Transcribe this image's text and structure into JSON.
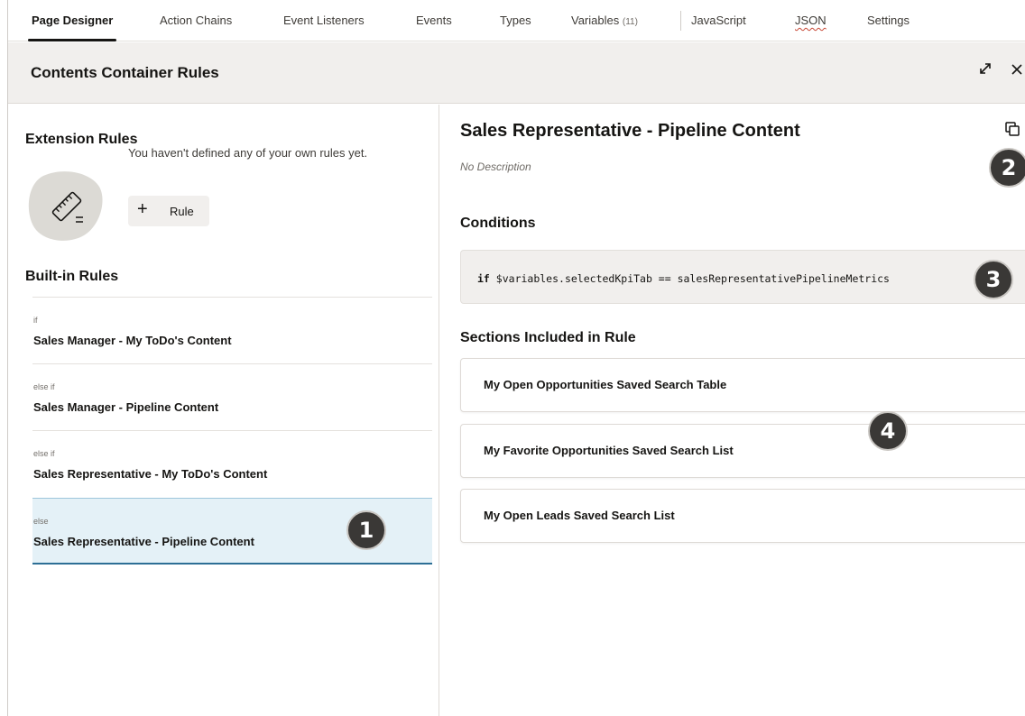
{
  "tabs": [
    {
      "label": "Page Designer",
      "active": true
    },
    {
      "label": "Action Chains"
    },
    {
      "label": "Event Listeners"
    },
    {
      "label": "Events"
    },
    {
      "label": "Types"
    },
    {
      "label": "Variables",
      "count": "(11)"
    },
    {
      "label": "JavaScript"
    },
    {
      "label": "JSON"
    },
    {
      "label": "Settings"
    }
  ],
  "header": {
    "title": "Contents Container Rules",
    "expand_icon": "expand-icon",
    "close_icon": "close-icon"
  },
  "left": {
    "extension_title": "Extension Rules",
    "empty_message": "You haven't defined any of your own rules yet.",
    "add_rule_label": "Rule",
    "builtin_title": "Built-in Rules",
    "rules": [
      {
        "keyword": "if",
        "name": "Sales Manager - My ToDo's Content"
      },
      {
        "keyword": "else if",
        "name": "Sales Manager - Pipeline Content"
      },
      {
        "keyword": "else if",
        "name": "Sales Representative - My ToDo's Content"
      },
      {
        "keyword": "else",
        "name": "Sales Representative - Pipeline Content",
        "selected": true
      }
    ]
  },
  "right": {
    "title": "Sales Representative - Pipeline Content",
    "description": "No Description",
    "conditions_title": "Conditions",
    "condition_keyword": "if",
    "condition_expr": "$variables.selectedKpiTab == salesRepresentativePipelineMetrics",
    "sections_title": "Sections Included in Rule",
    "sections": [
      "My Open Opportunities Saved Search Table",
      "My Favorite Opportunities Saved Search List",
      "My Open Leads Saved Search List"
    ]
  },
  "callouts": [
    "1",
    "2",
    "3",
    "4"
  ],
  "colors": {
    "selected_bg": "#e4f1f7",
    "selected_border": "#2d6f95",
    "header_bg": "#f1efed",
    "callout_bg": "#3a3836"
  }
}
